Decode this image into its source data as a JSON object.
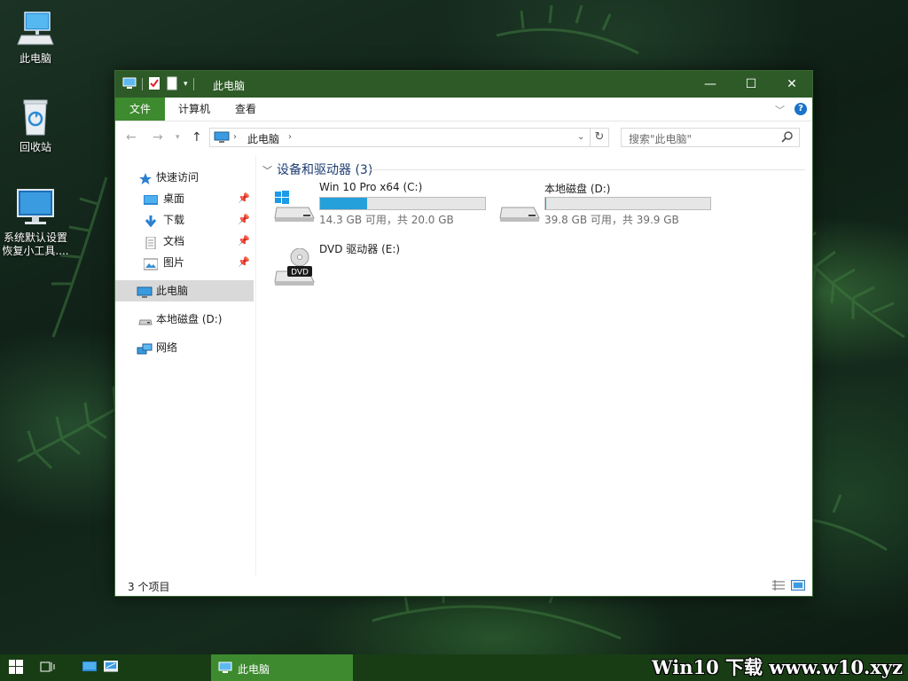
{
  "desktop": {
    "icons": [
      {
        "label": "此电脑"
      },
      {
        "label": "回收站"
      },
      {
        "label": "系统默认设置恢复小工具...."
      }
    ]
  },
  "window": {
    "title": "此电脑",
    "controls": {
      "minimize": "—",
      "maximize": "☐",
      "close": "✕"
    },
    "ribbon": {
      "tabs": [
        {
          "label": "文件"
        },
        {
          "label": "计算机"
        },
        {
          "label": "查看"
        }
      ],
      "help": "?"
    },
    "address": {
      "crumb": "此电脑",
      "search_placeholder": "搜索\"此电脑\""
    },
    "navpane": {
      "quick_access": "快速访问",
      "items": [
        {
          "label": "桌面"
        },
        {
          "label": "下载"
        },
        {
          "label": "文档"
        },
        {
          "label": "图片"
        }
      ],
      "this_pc": "此电脑",
      "local_d": "本地磁盘 (D:)",
      "network": "网络"
    },
    "content": {
      "group_title": "设备和驱动器 (3)",
      "drives": [
        {
          "name": "Win 10 Pro x64 (C:)",
          "info": "14.3 GB 可用，共 20.0 GB",
          "used_fraction": 0.285
        },
        {
          "name": "本地磁盘 (D:)",
          "info": "39.8 GB 可用，共 39.9 GB",
          "used_fraction": 0.003
        },
        {
          "name": "DVD 驱动器 (E:)",
          "badge": "DVD"
        }
      ]
    },
    "status": {
      "count": "3 个项目"
    }
  },
  "taskbar": {
    "active_title": "此电脑",
    "watermark": "Win10 下载 www.w10.xyz"
  },
  "colors": {
    "titlebar": "#2d5a27",
    "file_tab": "#3d8a2f",
    "taskbar": "#183d14",
    "progress": "#26a0da"
  }
}
